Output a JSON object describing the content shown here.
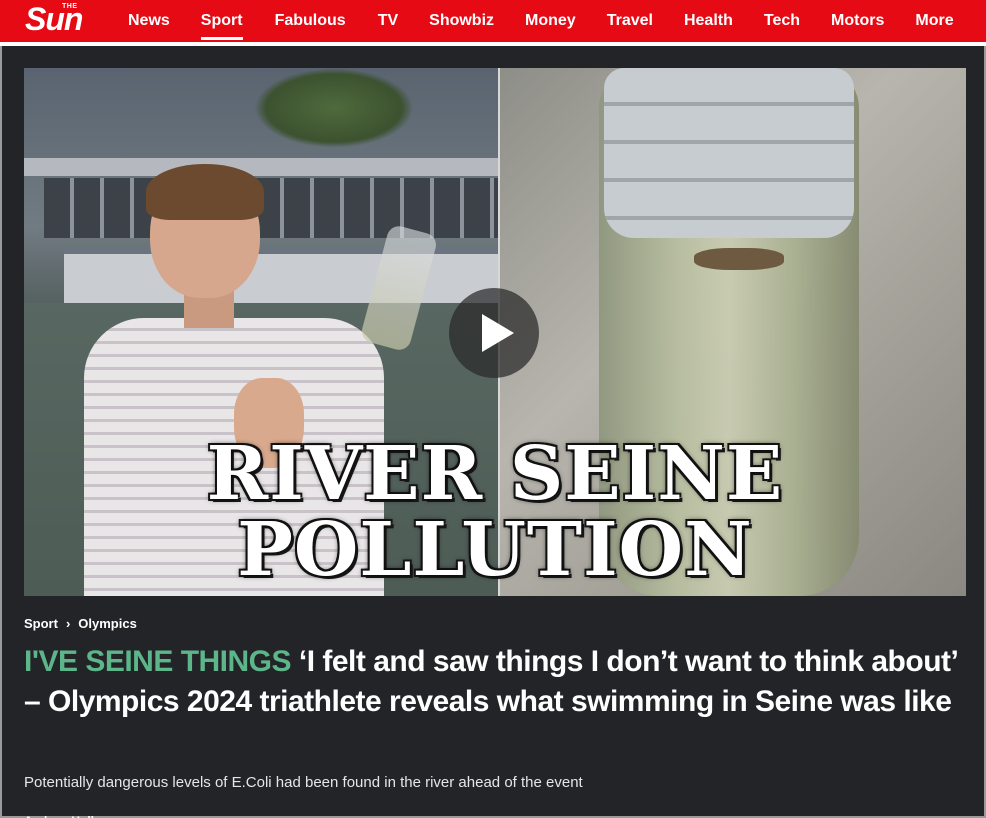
{
  "nav": {
    "logo_small": "THE",
    "logo_word": "Sun",
    "items": [
      {
        "label": "News"
      },
      {
        "label": "Sport",
        "active": true
      },
      {
        "label": "Fabulous"
      },
      {
        "label": "TV"
      },
      {
        "label": "Showbiz"
      },
      {
        "label": "Money"
      },
      {
        "label": "Travel"
      },
      {
        "label": "Health"
      },
      {
        "label": "Tech"
      },
      {
        "label": "Motors"
      },
      {
        "label": "More"
      }
    ],
    "bg_color": "#e60a14"
  },
  "hero": {
    "overlay_line1": "RIVER SEINE",
    "overlay_line2": "POLLUTION",
    "play_icon": "play-icon"
  },
  "breadcrumb": {
    "items": [
      "Sport",
      "Olympics"
    ],
    "separator_icon": "chevron-right-icon"
  },
  "article": {
    "kicker": "I'VE SEINE THINGS",
    "headline": "‘I felt and saw things I don’t want to think about’ – Olympics 2024 triathlete reveals what swimming in Seine was like",
    "standfirst": "Potentially dangerous levels of E.Coli had been found in the river ahead of the event",
    "kicker_color": "#5db68a"
  }
}
